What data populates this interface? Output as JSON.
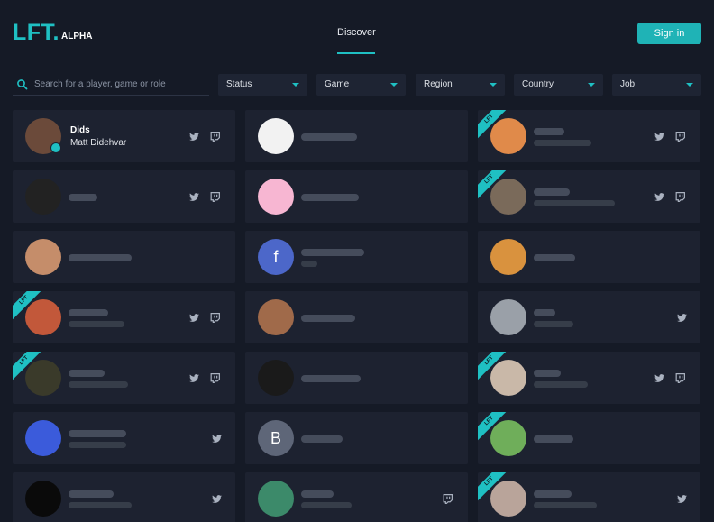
{
  "logo": {
    "main": "LFT.",
    "sub": "ALPHA"
  },
  "nav": {
    "discover": "Discover"
  },
  "header": {
    "signin": "Sign in"
  },
  "search": {
    "placeholder": "Search for a player, game or role"
  },
  "filters": [
    {
      "label": "Status"
    },
    {
      "label": "Game"
    },
    {
      "label": "Region"
    },
    {
      "label": "Country"
    },
    {
      "label": "Job"
    }
  ],
  "profiles": [
    {
      "name": "Dids",
      "subtitle": "Matt Didehvar",
      "verified": true,
      "lft": false,
      "twitter": true,
      "twitch": true,
      "avatar_color": "#6b4a3a"
    },
    {
      "name": "",
      "subtitle": "",
      "lft": false,
      "twitter": false,
      "twitch": false,
      "avatar_color": "#f2f2f2"
    },
    {
      "name": "",
      "subtitle": "",
      "lft": true,
      "twitter": true,
      "twitch": true,
      "avatar_color": "#e08a4a"
    },
    {
      "name": "",
      "subtitle": "",
      "lft": false,
      "twitter": true,
      "twitch": true,
      "avatar_color": "#222222"
    },
    {
      "name": "",
      "subtitle": "",
      "lft": false,
      "twitter": false,
      "twitch": false,
      "avatar_color": "#f7b6d2"
    },
    {
      "name": "",
      "subtitle": "",
      "lft": true,
      "twitter": true,
      "twitch": true,
      "avatar_color": "#7a6a5a"
    },
    {
      "name": "",
      "subtitle": "",
      "lft": false,
      "twitter": false,
      "twitch": false,
      "avatar_color": "#c58d6a"
    },
    {
      "name": "",
      "subtitle": "",
      "lft": false,
      "twitter": false,
      "twitch": false,
      "avatar_color": "#4c67c9",
      "avatar_letter": "f"
    },
    {
      "name": "",
      "subtitle": "",
      "lft": false,
      "twitter": false,
      "twitch": false,
      "avatar_color": "#d9923e"
    },
    {
      "name": "",
      "subtitle": "",
      "lft": true,
      "twitter": true,
      "twitch": true,
      "avatar_color": "#c2583a"
    },
    {
      "name": "",
      "subtitle": "",
      "lft": false,
      "twitter": false,
      "twitch": false,
      "avatar_color": "#a06a4a"
    },
    {
      "name": "",
      "subtitle": "",
      "lft": false,
      "twitter": true,
      "twitch": false,
      "avatar_color": "#9aa0a8"
    },
    {
      "name": "",
      "subtitle": "",
      "lft": true,
      "twitter": true,
      "twitch": true,
      "avatar_color": "#3a3a2a"
    },
    {
      "name": "",
      "subtitle": "",
      "lft": false,
      "twitter": false,
      "twitch": false,
      "avatar_color": "#1a1a1a"
    },
    {
      "name": "",
      "subtitle": "",
      "lft": true,
      "twitter": true,
      "twitch": true,
      "avatar_color": "#c9b8a8"
    },
    {
      "name": "",
      "subtitle": "",
      "lft": false,
      "twitter": true,
      "twitch": false,
      "avatar_color": "#3b5bdb"
    },
    {
      "name": "",
      "subtitle": "",
      "lft": false,
      "twitter": false,
      "twitch": false,
      "avatar_color": "#5e6678",
      "avatar_letter": "B"
    },
    {
      "name": "",
      "subtitle": "",
      "lft": true,
      "twitter": false,
      "twitch": false,
      "avatar_color": "#6fae5a"
    },
    {
      "name": "",
      "subtitle": "",
      "lft": false,
      "twitter": true,
      "twitch": false,
      "avatar_color": "#0a0a0a"
    },
    {
      "name": "",
      "subtitle": "",
      "lft": false,
      "twitter": false,
      "twitch": true,
      "avatar_color": "#3c8a6a"
    },
    {
      "name": "",
      "subtitle": "",
      "lft": true,
      "twitter": true,
      "twitch": false,
      "avatar_color": "#b9a49a"
    }
  ],
  "ribbon_label": "LFT",
  "colors": {
    "accent": "#1fc0c3",
    "background": "#151a26",
    "card": "#1d2230"
  }
}
